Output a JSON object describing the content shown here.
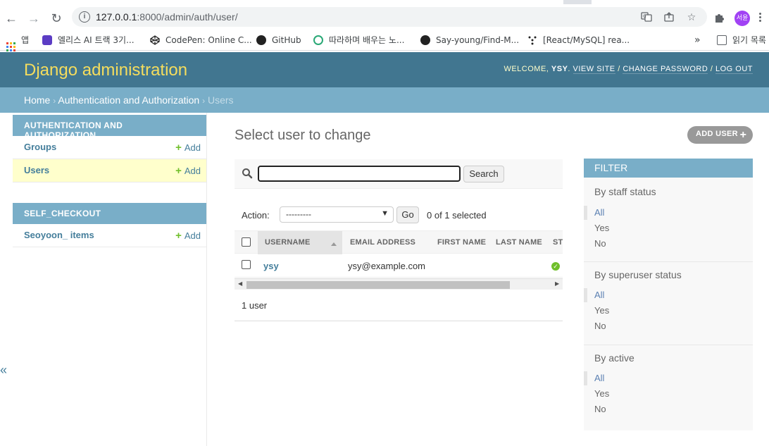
{
  "browser": {
    "url_host": "127.0.0.1",
    "url_rest": ":8000/admin/auth/user/",
    "profile_initials": "서윤",
    "bookmarks": [
      {
        "label": "앱",
        "icon": "apps-grid-icon"
      },
      {
        "label": "엘리스 AI 트랙 3기...",
        "icon": "elice-icon"
      },
      {
        "label": "CodePen: Online C...",
        "icon": "codepen-icon"
      },
      {
        "label": "GitHub",
        "icon": "github-icon"
      },
      {
        "label": "따라하며 배우는 노...",
        "icon": "course-icon"
      },
      {
        "label": "Say-young/Find-M...",
        "icon": "github-icon"
      },
      {
        "label": "[React/MySQL] rea...",
        "icon": "velog-icon"
      }
    ],
    "reading_list": "읽기 목록",
    "more_bookmarks": "»"
  },
  "header": {
    "branding": "Django administration",
    "welcome": "WELCOME, ",
    "username": "YSY",
    "view_site": "VIEW SITE",
    "change_password": "CHANGE PASSWORD",
    "log_out": "LOG OUT",
    "sep": " / "
  },
  "breadcrumbs": {
    "home": "Home",
    "app": "Authentication and Authorization",
    "current": "Users",
    "sep": "›"
  },
  "sidebar": {
    "modules": [
      {
        "caption": "AUTHENTICATION AND AUTHORIZATION",
        "rows": [
          {
            "name": "Groups",
            "add": "Add",
            "current": false
          },
          {
            "name": "Users",
            "add": "Add",
            "current": true
          }
        ]
      },
      {
        "caption": "SELF_CHECKOUT",
        "rows": [
          {
            "name": "Seoyoon_ items",
            "add": "Add",
            "current": false
          }
        ]
      }
    ],
    "collapse": "«"
  },
  "content": {
    "title": "Select user to change",
    "add_button": "ADD USER",
    "search": {
      "value": "",
      "button": "Search"
    },
    "actions": {
      "label": "Action:",
      "selected": "---------",
      "go": "Go",
      "counter": "0 of 1 selected"
    },
    "table": {
      "columns": [
        "USERNAME",
        "EMAIL ADDRESS",
        "FIRST NAME",
        "LAST NAME",
        "STAFF STATUS"
      ],
      "visible_last_col": "ST",
      "rows": [
        {
          "username": "ysy",
          "email": "ysy@example.com",
          "first_name": "",
          "last_name": "",
          "staff_status": true
        }
      ]
    },
    "paginator": "1 user"
  },
  "filter": {
    "title": "FILTER",
    "groups": [
      {
        "title": "By staff status",
        "options": [
          "All",
          "Yes",
          "No"
        ],
        "selected": 0
      },
      {
        "title": "By superuser status",
        "options": [
          "All",
          "Yes",
          "No"
        ],
        "selected": 0
      },
      {
        "title": "By active",
        "options": [
          "All",
          "Yes",
          "No"
        ],
        "selected": 0
      }
    ]
  },
  "colors": {
    "header_bg": "#417690",
    "branding": "#f5dd5d",
    "breadcrumb_bg": "#79aec8",
    "link": "#447e9b",
    "current_row": "#ffffcc",
    "add_green": "#70bf2b"
  }
}
